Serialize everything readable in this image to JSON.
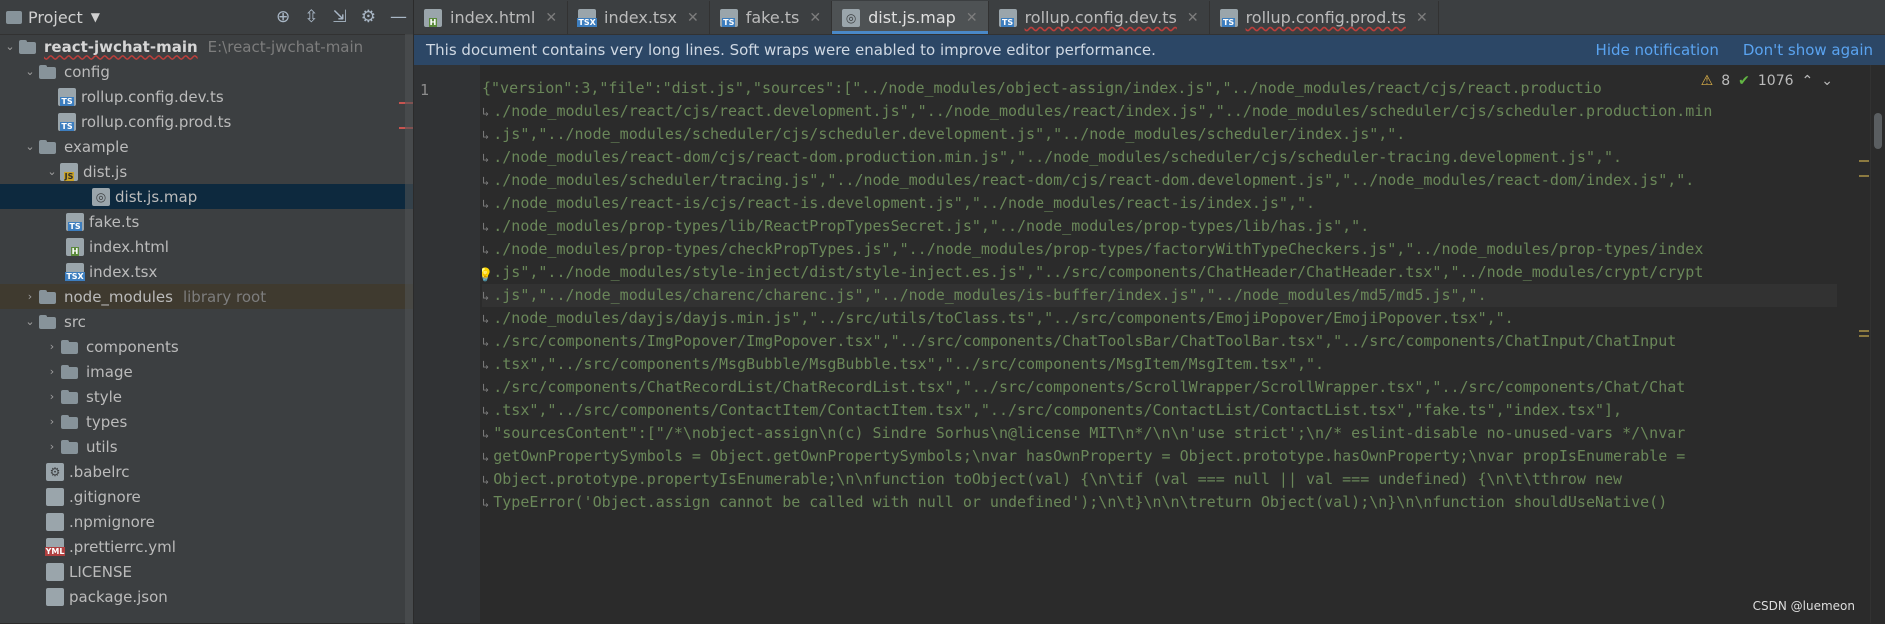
{
  "project": {
    "title": "Project",
    "root": {
      "name": "react-jwchat-main",
      "path": "E:\\react-jwchat-main"
    },
    "items": [
      {
        "label": "config"
      },
      {
        "label": "rollup.config.dev.ts"
      },
      {
        "label": "rollup.config.prod.ts"
      },
      {
        "label": "example"
      },
      {
        "label": "dist.js"
      },
      {
        "label": "dist.js.map"
      },
      {
        "label": "fake.ts"
      },
      {
        "label": "index.html"
      },
      {
        "label": "index.tsx"
      },
      {
        "label": "node_modules",
        "hint": "library root"
      },
      {
        "label": "src"
      },
      {
        "label": "components"
      },
      {
        "label": "image"
      },
      {
        "label": "style"
      },
      {
        "label": "types"
      },
      {
        "label": "utils"
      },
      {
        "label": ".babelrc"
      },
      {
        "label": ".gitignore"
      },
      {
        "label": ".npmignore"
      },
      {
        "label": ".prettierrc.yml"
      },
      {
        "label": "LICENSE"
      },
      {
        "label": "package.json"
      }
    ]
  },
  "tabs": [
    {
      "label": "index.html",
      "type": "html"
    },
    {
      "label": "index.tsx",
      "type": "tsx"
    },
    {
      "label": "fake.ts",
      "type": "ts"
    },
    {
      "label": "dist.js.map",
      "type": "map",
      "active": true
    },
    {
      "label": "rollup.config.dev.ts",
      "type": "ts"
    },
    {
      "label": "rollup.config.prod.ts",
      "type": "ts"
    }
  ],
  "notification": {
    "message": "This document contains very long lines. Soft wraps were enabled to improve editor performance.",
    "hide": "Hide notification",
    "dont_show": "Don't show again"
  },
  "editor": {
    "line_number": "1",
    "warnings": "8",
    "ok_count": "1076",
    "lines": [
      "{\"version\":3,\"file\":\"dist.js\",\"sources\":[\"../node_modules/object-assign/index.js\",\"../node_modules/react/cjs/react.productio",
      "./node_modules/react/cjs/react.development.js\",\"../node_modules/react/index.js\",\"../node_modules/scheduler/cjs/scheduler.production.min",
      ".js\",\"../node_modules/scheduler/cjs/scheduler.development.js\",\"../node_modules/scheduler/index.js\",\".",
      "./node_modules/react-dom/cjs/react-dom.production.min.js\",\"../node_modules/scheduler/cjs/scheduler-tracing.development.js\",\".",
      "./node_modules/scheduler/tracing.js\",\"../node_modules/react-dom/cjs/react-dom.development.js\",\"../node_modules/react-dom/index.js\",\".",
      "./node_modules/react-is/cjs/react-is.development.js\",\"../node_modules/react-is/index.js\",\".",
      "./node_modules/prop-types/lib/ReactPropTypesSecret.js\",\"../node_modules/prop-types/lib/has.js\",\".",
      "./node_modules/prop-types/checkPropTypes.js\",\"../node_modules/prop-types/factoryWithTypeCheckers.js\",\"../node_modules/prop-types/index",
      ".js\",\"../node_modules/style-inject/dist/style-inject.es.js\",\"../src/components/ChatHeader/ChatHeader.tsx\",\"../node_modules/crypt/crypt",
      ".js\",\"../node_modules/charenc/charenc.js\",\"../node_modules/is-buffer/index.js\",\"../node_modules/md5/md5.js\",\".",
      "./node_modules/dayjs/dayjs.min.js\",\"../src/utils/toClass.ts\",\"../src/components/EmojiPopover/EmojiPopover.tsx\",\".",
      "./src/components/ImgPopover/ImgPopover.tsx\",\"../src/components/ChatToolsBar/ChatToolBar.tsx\",\"../src/components/ChatInput/ChatInput",
      ".tsx\",\"../src/components/MsgBubble/MsgBubble.tsx\",\"../src/components/MsgItem/MsgItem.tsx\",\".",
      "./src/components/ChatRecordList/ChatRecordList.tsx\",\"../src/components/ScrollWrapper/ScrollWrapper.tsx\",\"../src/components/Chat/Chat",
      ".tsx\",\"../src/components/ContactItem/ContactItem.tsx\",\"../src/components/ContactList/ContactList.tsx\",\"fake.ts\",\"index.tsx\"],",
      "\"sourcesContent\":[\"/*\\nobject-assign\\n(c) Sindre Sorhus\\n@license MIT\\n*/\\n\\n'use strict';\\n/* eslint-disable no-unused-vars */\\nvar",
      "getOwnPropertySymbols = Object.getOwnPropertySymbols;\\nvar hasOwnProperty = Object.prototype.hasOwnProperty;\\nvar propIsEnumerable =",
      "Object.prototype.propertyIsEnumerable;\\n\\nfunction toObject(val) {\\n\\tif (val === null || val === undefined) {\\n\\t\\tthrow new",
      "TypeError('Object.assign cannot be called with null or undefined');\\n\\t}\\n\\n\\treturn Object(val);\\n}\\n\\nfunction shouldUseNative()"
    ]
  },
  "watermark": "CSDN @luemeon",
  "colors": {
    "accent": "#4a88c7",
    "notification_bg": "#2c4766",
    "link": "#5aa3f0"
  }
}
